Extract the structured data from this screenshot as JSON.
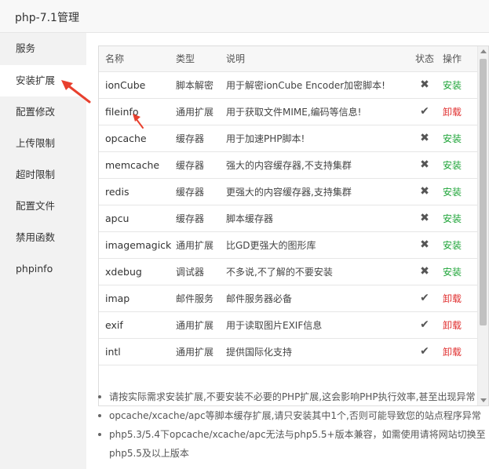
{
  "window": {
    "title": "php-7.1管理"
  },
  "sidebar": {
    "items": [
      {
        "label": "服务",
        "active": false
      },
      {
        "label": "安装扩展",
        "active": true
      },
      {
        "label": "配置修改",
        "active": false
      },
      {
        "label": "上传限制",
        "active": false
      },
      {
        "label": "超时限制",
        "active": false
      },
      {
        "label": "配置文件",
        "active": false
      },
      {
        "label": "禁用函数",
        "active": false
      },
      {
        "label": "phpinfo",
        "active": false
      }
    ]
  },
  "table": {
    "headers": {
      "name": "名称",
      "type": "类型",
      "desc": "说明",
      "status": "状态",
      "op": "操作"
    },
    "rows": [
      {
        "name": "ionCube",
        "type": "脚本解密",
        "desc": "用于解密ionCube Encoder加密脚本!",
        "status_icon": "cross-icon",
        "op": "安装"
      },
      {
        "name": "fileinfo",
        "type": "通用扩展",
        "desc": "用于获取文件MIME,编码等信息!",
        "status_icon": "check-icon",
        "op": "卸载"
      },
      {
        "name": "opcache",
        "type": "缓存器",
        "desc": "用于加速PHP脚本!",
        "status_icon": "cross-icon",
        "op": "安装"
      },
      {
        "name": "memcache",
        "type": "缓存器",
        "desc": "强大的内容缓存器,不支持集群",
        "status_icon": "cross-icon",
        "op": "安装"
      },
      {
        "name": "redis",
        "type": "缓存器",
        "desc": "更强大的内容缓存器,支持集群",
        "status_icon": "cross-icon",
        "op": "安装"
      },
      {
        "name": "apcu",
        "type": "缓存器",
        "desc": "脚本缓存器",
        "status_icon": "cross-icon",
        "op": "安装"
      },
      {
        "name": "imagemagick",
        "type": "通用扩展",
        "desc": "比GD更强大的图形库",
        "status_icon": "cross-icon",
        "op": "安装"
      },
      {
        "name": "xdebug",
        "type": "调试器",
        "desc": "不多说,不了解的不要安装",
        "status_icon": "cross-icon",
        "op": "安装"
      },
      {
        "name": "imap",
        "type": "邮件服务",
        "desc": "邮件服务器必备",
        "status_icon": "check-icon",
        "op": "卸载"
      },
      {
        "name": "exif",
        "type": "通用扩展",
        "desc": "用于读取图片EXIF信息",
        "status_icon": "check-icon",
        "op": "卸载"
      },
      {
        "name": "intl",
        "type": "通用扩展",
        "desc": "提供国际化支持",
        "status_icon": "check-icon",
        "op": "卸载"
      }
    ]
  },
  "notes": [
    "请按实际需求安装扩展,不要安装不必要的PHP扩展,这会影响PHP执行效率,甚至出现异常",
    "opcache/xcache/apc等脚本缓存扩展,请只安装其中1个,否则可能导致您的站点程序异常",
    "php5.3/5.4下opcache/xcache/apc无法与php5.5+版本兼容，如需使用请将网站切换至php5.5及以上版本"
  ],
  "colors": {
    "install": "#20a53a",
    "uninstall": "#e03030",
    "arrow": "#e8402e"
  }
}
